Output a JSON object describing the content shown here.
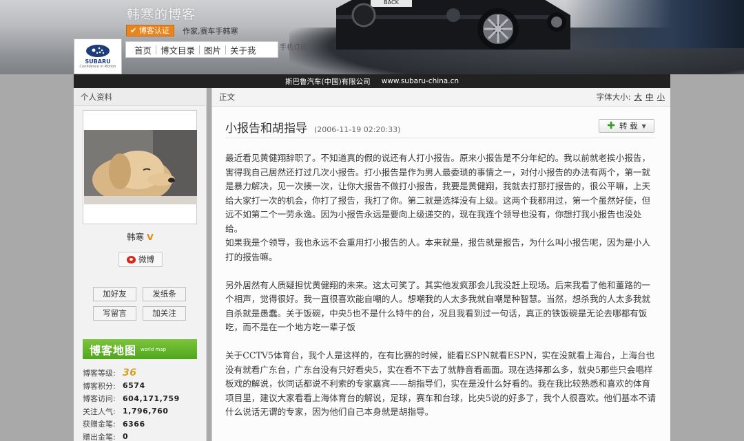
{
  "header": {
    "blog_title": "韩寒的博客",
    "cert_badge": "博客认证",
    "cert_desc": "作家,赛车手韩寒",
    "mobile_subscribe": "手机订阅",
    "logo_brand": "SUBARU",
    "logo_slogan": "Confidence in Motion",
    "nav": [
      "首页",
      "博文目录",
      "图片",
      "关于我"
    ],
    "sponsor_name": "斯巴鲁汽车(中国)有限公司",
    "sponsor_url": "www.subaru-china.cn"
  },
  "sidebar": {
    "section_title": "个人资料",
    "author_name": "韩寒",
    "weibo_label": "微博",
    "buttons": [
      "加好友",
      "发纸条",
      "写留言",
      "加关注"
    ],
    "map_title": "博客地图",
    "map_sub": "world map",
    "stats": [
      {
        "label": "博客等级:",
        "value": "36"
      },
      {
        "label": "博客积分:",
        "value": "6574"
      },
      {
        "label": "博客访问:",
        "value": "604,171,759"
      },
      {
        "label": "关注人气:",
        "value": "1,796,760"
      },
      {
        "label": "获赠金笔:",
        "value": "6366"
      },
      {
        "label": "赠出金笔:",
        "value": "0"
      }
    ]
  },
  "main": {
    "section_label": "正文",
    "font_size_label": "字体大小:",
    "font_sizes": [
      "大",
      "中",
      "小"
    ],
    "post_title": "小报告和胡指导",
    "post_time": "(2006-11-19 02:20:33)",
    "repost_label": "转 载",
    "paragraphs": [
      "最近看见黄健翔辞职了。不知道真的假的说还有人打小报告。原来小报告是不分年纪的。我以前就老挨小报告，害得我自己居然还打过几次小报告。打小报告是作为男人最委琐的事情之一，对付小报告的办法有两个，第一就是暴力解决，见一次揍一次，让你大报告不做打小报告，我要是黄健翔，我就去打那打报告的，很公平嘛，上天给大家打一次的机会，你打了报告，我打了你。第二就是选择没有上级。这两个我都用过，第一个虽然好使，但远不如第二个一劳永逸。因为小报告永远是要向上级递交的，现在我连个领导也没有，你想打我小报告也没处给。",
      "如果我是个领导，我也永远不会重用打小报告的人。本来就是，报告就是报告，为什么叫小报告呢，因为是小人打的报告嘛。",
      "另外居然有人质疑担忧黄健翔的未来。这太可笑了。其实他发疯那会儿我没赶上现场。后来我看了他和董路的一个相声，觉得很好。我一直很喜欢能自嘲的人。想嘲我的人太多我就自嘲是种智慧。当然，想杀我的人太多我就自杀就是愚蠢。关于饭碗，中央5也不是什么特牛的台，况且我看到过一句话，真正的铁饭碗是无论去哪都有饭吃，而不是在一个地方吃一辈子饭",
      "关于CCTV5体育台，我个人是这样的，在有比赛的时候，能看ESPN就看ESPN，实在没就看上海台，上海台也没有就看广东台，广东台没有只好看央5，实在看不下去了就静音看画面。现在选择那么多，就央5那些只会唱样板戏的解说，伙同话都说不利索的专家嘉宾——胡指导们，实在是没什么好看的。我在我比较熟悉和喜欢的体育项目里，建议大家看看上海体育台的解说，足球，赛车和台球，比央5说的好多了，我个人很喜欢。他们基本不请什么说话无谓的专家，因为他们自己本身就是胡指导。"
    ]
  }
}
